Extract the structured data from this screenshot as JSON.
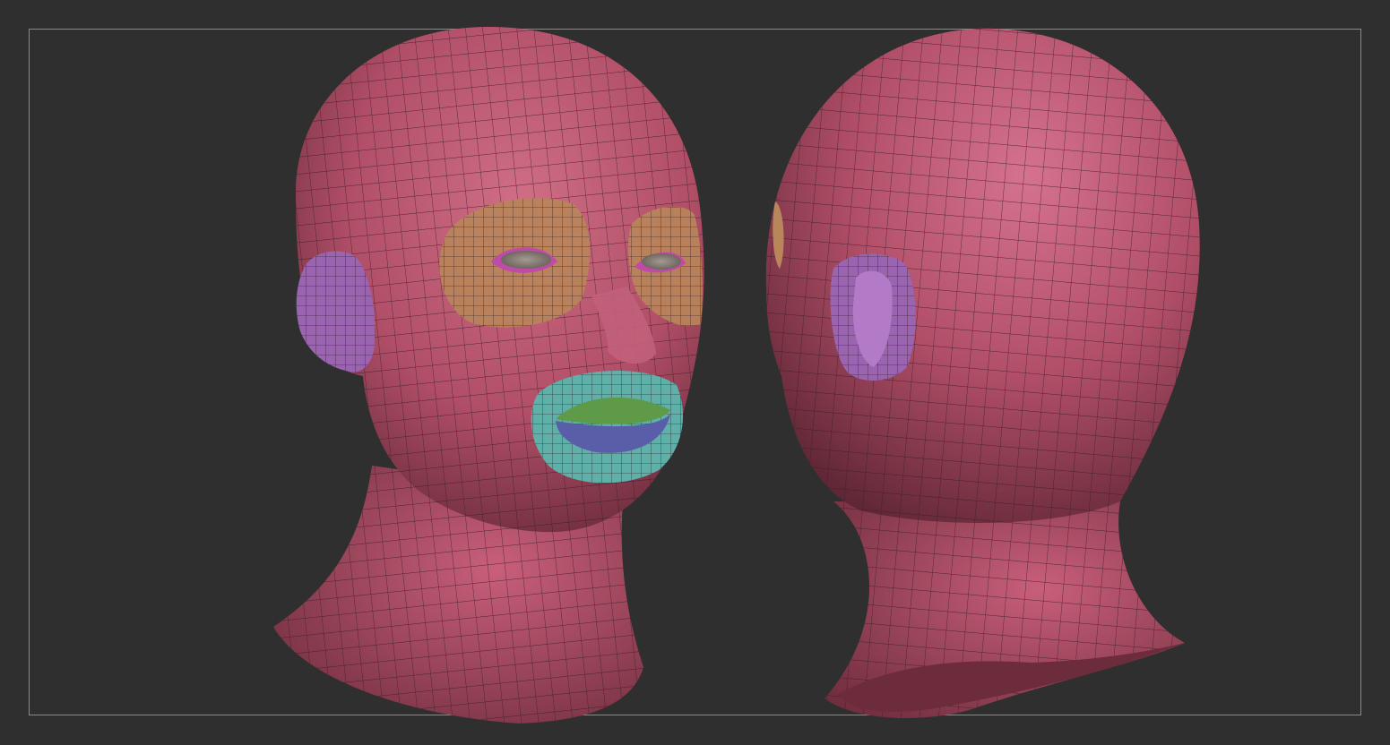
{
  "viewport": {
    "background": "#2f2f2f",
    "frame_color": "#8a8a8a"
  },
  "models": [
    {
      "view": "front-three-quarter"
    },
    {
      "view": "back-three-quarter"
    }
  ],
  "polygroups": {
    "skin": "#b85068",
    "eye_socket": "#b8865a",
    "ear": "#9b64b0",
    "mouth_ring": "#5fb0a8",
    "upper_lip": "#5e9a48",
    "lower_lip": "#5a5ea8",
    "eyelid_rim": "#c04aa8",
    "eyeball": "#8b807a",
    "wire": "#3a1d28"
  }
}
